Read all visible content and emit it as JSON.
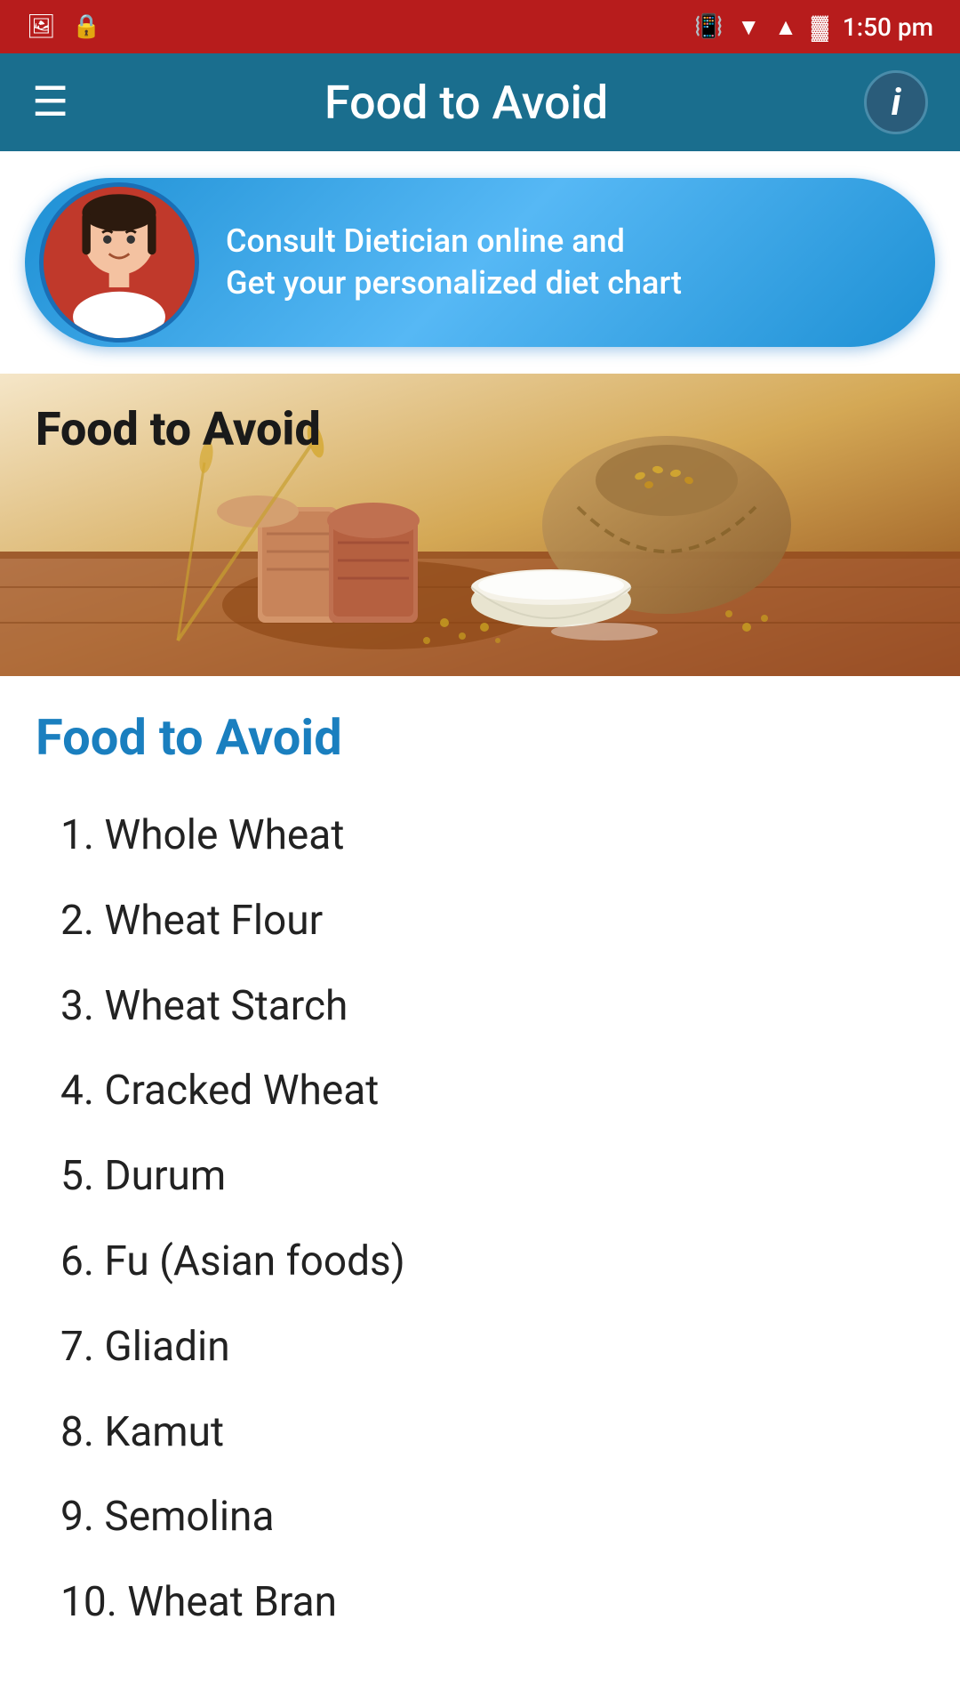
{
  "statusBar": {
    "time": "1:50 pm",
    "icons": {
      "image": "🖼",
      "lock": "🔒",
      "vibrate": "📳",
      "wifi": "▲",
      "signal": "▲",
      "battery": "🔋"
    }
  },
  "navBar": {
    "title": "Food to Avoid",
    "hamburger": "☰",
    "infoButton": "i"
  },
  "banner": {
    "line1": "Consult Dietician online and",
    "line2": "Get your personalized diet chart"
  },
  "heroImage": {
    "label": "Food to Avoid"
  },
  "content": {
    "sectionTitle": "Food to Avoid",
    "items": [
      "1. Whole Wheat",
      "2. Wheat Flour",
      "3. Wheat Starch",
      "4. Cracked Wheat",
      "5. Durum",
      "6. Fu (Asian foods)",
      "7. Gliadin",
      "8. Kamut",
      "9. Semolina",
      "10. Wheat Bran"
    ]
  }
}
